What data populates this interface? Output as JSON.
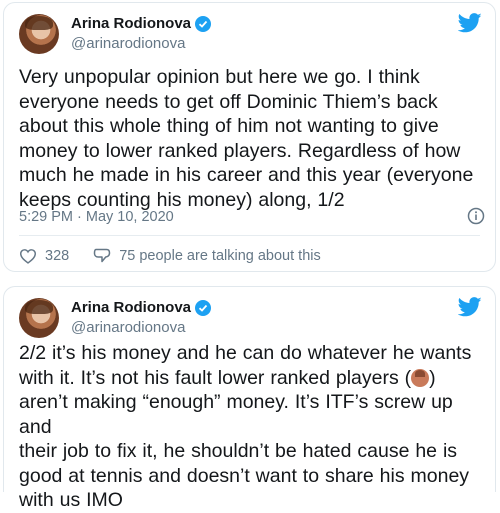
{
  "tweets": [
    {
      "name": "Arina Rodionova",
      "handle": "@arinarodionova",
      "lines": [
        "Very unpopular opinion but here we go. I think",
        "everyone needs to get off Dominic Thiem’s back",
        "about this whole thing of him not wanting to give",
        "money to lower ranked players. Regardless of how",
        "much he made in his career and this year (everyone",
        "keeps counting his money) along, 1/2"
      ],
      "timestamp": "5:29 PM · May 10, 2020",
      "likes": "328",
      "talking": "75 people are talking about this"
    },
    {
      "name": "Arina Rodionova",
      "handle": "@arinarodionova",
      "lines": [
        "2/2 it’s his money and he can do whatever he wants",
        "with it. It’s not his fault lower ranked players (",
        "aren’t making “enough” money. It’s ITF’s screw up and",
        "their job to fix it, he shouldn’t be hated cause he is",
        "good at tennis and doesn’t want to share his money",
        "with us IMO"
      ],
      "line2_suffix": ")"
    }
  ],
  "colors": {
    "twitter_blue": "#1da1f2",
    "text": "#14171a",
    "muted": "#657786",
    "border": "#e1e8ed"
  },
  "icons": [
    "verified-icon",
    "twitter-bird-icon",
    "info-icon",
    "heart-icon",
    "comment-icon",
    "woman-raising-hand-emoji"
  ]
}
